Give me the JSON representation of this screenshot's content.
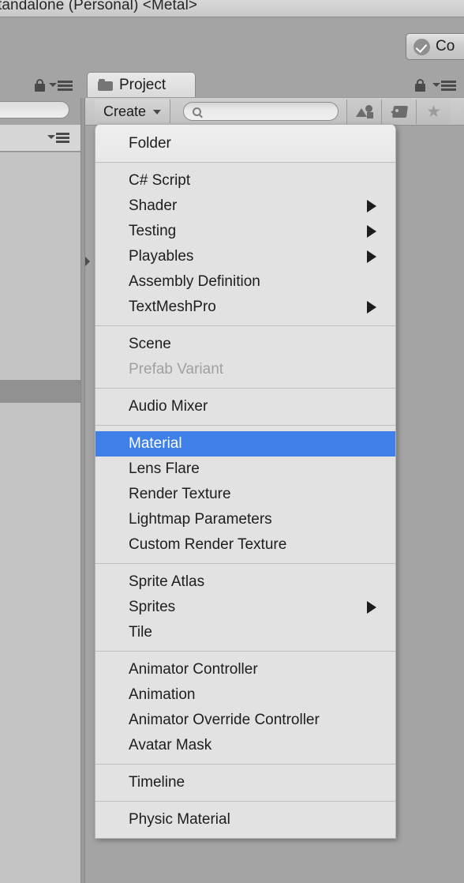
{
  "window": {
    "title": "tandalone (Personal) <Metal>"
  },
  "toolbar_top": {
    "collab_label": "Co",
    "collab_icon": "check-circle-icon"
  },
  "left_panel": {
    "lock_icon": "lock-icon",
    "menu_icon": "hamburger-menu-icon",
    "search_value": "",
    "sub_menu_icon": "hamburger-menu-icon"
  },
  "project_panel": {
    "tab_label": "Project",
    "tab_icon": "folder-icon",
    "lock_icon": "lock-icon",
    "menu_icon": "hamburger-menu-icon",
    "create_label": "Create",
    "create_caret": "chevron-down-icon",
    "search": {
      "value": "",
      "placeholder": "",
      "icon": "search-icon"
    },
    "filters": [
      {
        "name": "type-filter",
        "icon": "shapes-icon"
      },
      {
        "name": "label-filter",
        "icon": "tag-icon"
      },
      {
        "name": "favorites-filter",
        "icon": "star-icon"
      }
    ]
  },
  "create_menu": {
    "sections": [
      {
        "id": "folder",
        "items": [
          {
            "label": "Folder",
            "submenu": false,
            "disabled": false,
            "selected": false
          }
        ]
      },
      {
        "id": "scripting",
        "items": [
          {
            "label": "C# Script",
            "submenu": false,
            "disabled": false,
            "selected": false
          },
          {
            "label": "Shader",
            "submenu": true,
            "disabled": false,
            "selected": false
          },
          {
            "label": "Testing",
            "submenu": true,
            "disabled": false,
            "selected": false
          },
          {
            "label": "Playables",
            "submenu": true,
            "disabled": false,
            "selected": false
          },
          {
            "label": "Assembly Definition",
            "submenu": false,
            "disabled": false,
            "selected": false
          },
          {
            "label": "TextMeshPro",
            "submenu": true,
            "disabled": false,
            "selected": false
          }
        ]
      },
      {
        "id": "scene",
        "items": [
          {
            "label": "Scene",
            "submenu": false,
            "disabled": false,
            "selected": false
          },
          {
            "label": "Prefab Variant",
            "submenu": false,
            "disabled": true,
            "selected": false
          }
        ]
      },
      {
        "id": "audio",
        "items": [
          {
            "label": "Audio Mixer",
            "submenu": false,
            "disabled": false,
            "selected": false
          }
        ]
      },
      {
        "id": "rendering",
        "items": [
          {
            "label": "Material",
            "submenu": false,
            "disabled": false,
            "selected": true
          },
          {
            "label": "Lens Flare",
            "submenu": false,
            "disabled": false,
            "selected": false
          },
          {
            "label": "Render Texture",
            "submenu": false,
            "disabled": false,
            "selected": false
          },
          {
            "label": "Lightmap Parameters",
            "submenu": false,
            "disabled": false,
            "selected": false
          },
          {
            "label": "Custom Render Texture",
            "submenu": false,
            "disabled": false,
            "selected": false
          }
        ]
      },
      {
        "id": "sprites",
        "items": [
          {
            "label": "Sprite Atlas",
            "submenu": false,
            "disabled": false,
            "selected": false
          },
          {
            "label": "Sprites",
            "submenu": true,
            "disabled": false,
            "selected": false
          },
          {
            "label": "Tile",
            "submenu": false,
            "disabled": false,
            "selected": false
          }
        ]
      },
      {
        "id": "animation",
        "items": [
          {
            "label": "Animator Controller",
            "submenu": false,
            "disabled": false,
            "selected": false
          },
          {
            "label": "Animation",
            "submenu": false,
            "disabled": false,
            "selected": false
          },
          {
            "label": "Animator Override Controller",
            "submenu": false,
            "disabled": false,
            "selected": false
          },
          {
            "label": "Avatar Mask",
            "submenu": false,
            "disabled": false,
            "selected": false
          }
        ]
      },
      {
        "id": "timeline",
        "items": [
          {
            "label": "Timeline",
            "submenu": false,
            "disabled": false,
            "selected": false
          }
        ]
      },
      {
        "id": "physics",
        "items": [
          {
            "label": "Physic Material",
            "submenu": false,
            "disabled": false,
            "selected": false
          }
        ]
      }
    ]
  },
  "colors": {
    "selection_blue": "#3f7fe8",
    "menu_background": "#e2e2e2",
    "editor_background": "#a4a4a4",
    "disabled_text": "#a0a0a0"
  }
}
